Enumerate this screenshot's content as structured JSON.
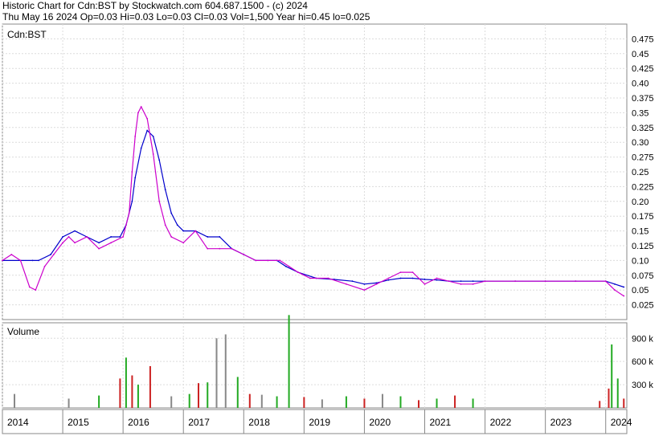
{
  "header": {
    "line1": "Historic Chart for Cdn:BST by Stockwatch.com 604.687.1500 - (c) 2024",
    "line2": "Thu May 16 2024  Op=0.03  Hi=0.03  Lo=0.03  Cl=0.03  Vol=1,500  Year hi=0.45  lo=0.025"
  },
  "chart_data": [
    {
      "type": "line",
      "title": "Cdn:BST",
      "ylim": [
        0.0,
        0.5
      ],
      "yticks": [
        "0.475",
        "0.45",
        "0.425",
        "0.40",
        "0.375",
        "0.35",
        "0.325",
        "0.30",
        "0.275",
        "0.25",
        "0.225",
        "0.20",
        "0.175",
        "0.15",
        "0.125",
        "0.10",
        "0.075",
        "0.05",
        "0.025"
      ],
      "x_labels": [
        "2014",
        "2015",
        "2016",
        "2017",
        "2018",
        "2019",
        "2020",
        "2021",
        "2022",
        "2023",
        "2024"
      ],
      "grid": true,
      "series": [
        {
          "color": "#0000cc",
          "x": [
            2014.0,
            2014.3,
            2014.5,
            2014.6,
            2014.8,
            2015.0,
            2015.2,
            2015.4,
            2015.6,
            2015.8,
            2015.95,
            2016.05,
            2016.15,
            2016.2,
            2016.3,
            2016.4,
            2016.5,
            2016.6,
            2016.7,
            2016.8,
            2016.9,
            2017.0,
            2017.2,
            2017.4,
            2017.6,
            2017.8,
            2018.0,
            2018.2,
            2018.4,
            2018.55,
            2018.7,
            2018.9,
            2019.2,
            2019.5,
            2019.8,
            2020.0,
            2020.2,
            2020.4,
            2020.6,
            2020.8,
            2021.0,
            2021.2,
            2021.4,
            2021.6,
            2021.8,
            2022.0,
            2022.5,
            2023.0,
            2023.5,
            2024.0,
            2024.15,
            2024.3
          ],
          "y": [
            0.1,
            0.1,
            0.1,
            0.1,
            0.11,
            0.14,
            0.15,
            0.14,
            0.13,
            0.14,
            0.14,
            0.16,
            0.2,
            0.24,
            0.29,
            0.32,
            0.31,
            0.27,
            0.22,
            0.18,
            0.16,
            0.15,
            0.15,
            0.14,
            0.14,
            0.12,
            0.11,
            0.1,
            0.1,
            0.1,
            0.09,
            0.08,
            0.07,
            0.068,
            0.065,
            0.06,
            0.062,
            0.067,
            0.07,
            0.07,
            0.068,
            0.067,
            0.065,
            0.065,
            0.065,
            0.065,
            0.065,
            0.065,
            0.065,
            0.065,
            0.06,
            0.055
          ]
        },
        {
          "color": "#cc00cc",
          "x": [
            2014.0,
            2014.15,
            2014.3,
            2014.45,
            2014.55,
            2014.7,
            2014.85,
            2015.0,
            2015.1,
            2015.2,
            2015.4,
            2015.6,
            2015.8,
            2016.0,
            2016.1,
            2016.15,
            2016.2,
            2016.25,
            2016.3,
            2016.4,
            2016.5,
            2016.6,
            2016.7,
            2016.8,
            2017.0,
            2017.2,
            2017.4,
            2017.6,
            2017.8,
            2018.0,
            2018.2,
            2018.4,
            2018.6,
            2018.75,
            2018.9,
            2019.1,
            2019.4,
            2019.7,
            2020.0,
            2020.2,
            2020.4,
            2020.6,
            2020.8,
            2021.0,
            2021.2,
            2021.4,
            2021.6,
            2021.8,
            2022.0,
            2022.5,
            2023.0,
            2023.5,
            2024.0,
            2024.15,
            2024.3
          ],
          "y": [
            0.1,
            0.11,
            0.1,
            0.055,
            0.05,
            0.09,
            0.11,
            0.13,
            0.14,
            0.13,
            0.14,
            0.12,
            0.13,
            0.14,
            0.18,
            0.25,
            0.31,
            0.35,
            0.36,
            0.34,
            0.28,
            0.2,
            0.16,
            0.14,
            0.13,
            0.15,
            0.12,
            0.12,
            0.12,
            0.11,
            0.1,
            0.1,
            0.1,
            0.09,
            0.08,
            0.07,
            0.07,
            0.06,
            0.05,
            0.06,
            0.07,
            0.08,
            0.08,
            0.06,
            0.07,
            0.065,
            0.06,
            0.06,
            0.065,
            0.065,
            0.065,
            0.065,
            0.065,
            0.05,
            0.04
          ]
        }
      ]
    },
    {
      "type": "bar",
      "title": "Volume",
      "ylim": [
        0,
        1100000
      ],
      "yticks": [
        "900 k",
        "600 k",
        "300 k"
      ],
      "x": [
        2014.2,
        2015.1,
        2015.6,
        2015.95,
        2016.05,
        2016.15,
        2016.25,
        2016.45,
        2016.8,
        2017.1,
        2017.25,
        2017.4,
        2017.55,
        2017.7,
        2017.9,
        2018.1,
        2018.3,
        2018.55,
        2018.75,
        2019.0,
        2019.3,
        2019.7,
        2020.0,
        2020.3,
        2020.6,
        2020.9,
        2021.2,
        2021.5,
        2021.8,
        2023.9,
        2024.05,
        2024.1,
        2024.2,
        2024.3
      ],
      "values": [
        180000,
        120000,
        160000,
        380000,
        650000,
        420000,
        300000,
        540000,
        150000,
        180000,
        320000,
        330000,
        900000,
        950000,
        400000,
        180000,
        170000,
        150000,
        1200000,
        140000,
        110000,
        150000,
        120000,
        180000,
        150000,
        100000,
        120000,
        160000,
        120000,
        90000,
        250000,
        820000,
        380000,
        120000
      ],
      "colors": [
        "#888888",
        "#888888",
        "#22aa22",
        "#cc2222",
        "#22aa22",
        "#cc2222",
        "#22aa22",
        "#cc2222",
        "#888888",
        "#22aa22",
        "#cc2222",
        "#22aa22",
        "#888888",
        "#888888",
        "#22aa22",
        "#cc2222",
        "#888888",
        "#22aa22",
        "#22aa22",
        "#cc2222",
        "#888888",
        "#22aa22",
        "#cc2222",
        "#888888",
        "#22aa22",
        "#cc2222",
        "#22aa22",
        "#cc2222",
        "#22aa22",
        "#cc2222",
        "#cc2222",
        "#22aa22",
        "#22aa22",
        "#cc2222"
      ]
    }
  ]
}
